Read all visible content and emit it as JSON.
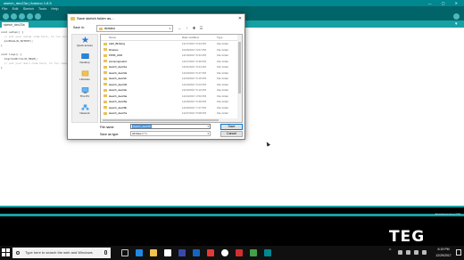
{
  "ide": {
    "title": "sketch_dec23a | Arduino 1.8.5",
    "menu": [
      "File",
      "Edit",
      "Sketch",
      "Tools",
      "Help"
    ],
    "tab": "sketch_dec23a",
    "code": [
      "void setup() {",
      "  // put your setup code here, to run once:",
      "  pinMode(8,OUTPUT);",
      "}",
      "",
      "void loop() {",
      "  digitalWrite(8,HIGH);",
      "  // put your main code here, to run repeatedly:",
      "}"
    ],
    "status": "Arduino/Genuino Uno on COM6",
    "accent": "#00878f"
  },
  "dialog": {
    "title": "Save sketch folder as...",
    "save_in_label": "Save in:",
    "save_in_value": "Arduino",
    "places": [
      "Quick access",
      "Desktop",
      "Libraries",
      "This PC",
      "Network"
    ],
    "columns": [
      "Name",
      "Date modified",
      "Type"
    ],
    "files": [
      {
        "name": "LED_Blinking",
        "date": "12/17/2017 6:34 PM",
        "type": "File folder"
      },
      {
        "name": "libraries",
        "date": "10/26/2017 6:57 PM",
        "type": "File folder"
      },
      {
        "name": "PWM_AKD",
        "date": "12/19/2017 6:34 PM",
        "type": "File folder"
      },
      {
        "name": "pwmpmgreehd",
        "date": "12/17/2017 6:36 PM",
        "type": "File folder"
      },
      {
        "name": "sketch_dec21a",
        "date": "12/21/2017 9:44 AM",
        "type": "File folder"
      },
      {
        "name": "sketch_dec23a",
        "date": "12/23/2017 5:27 PM",
        "type": "File folder"
      },
      {
        "name": "sketch_dec23c",
        "date": "12/23/2017 6:15 PM",
        "type": "File folder"
      },
      {
        "name": "sketch_dec23d",
        "date": "12/23/2017 6:23 PM",
        "type": "File folder"
      },
      {
        "name": "sketch_dec23e",
        "date": "12/23/2017 6:12 PM",
        "type": "File folder"
      },
      {
        "name": "sketch_dec24a",
        "date": "12/24/2017 2:53 PM",
        "type": "File folder"
      },
      {
        "name": "sketch_dec26a",
        "date": "12/26/2017 6:39 PM",
        "type": "File folder"
      },
      {
        "name": "sketch_dec26b",
        "date": "12/26/2017 7:27 PM",
        "type": "File folder"
      },
      {
        "name": "sketch_dec27a",
        "date": "12/27/2017 6:58 PM",
        "type": "File folder"
      }
    ],
    "file_name_label": "File name:",
    "file_name_value": "sketch_dec27b",
    "save_type_label": "Save as type:",
    "save_type_value": "All Files (*.*)",
    "save_button": "Save",
    "cancel_button": "Cancel",
    "close_glyph": "✕"
  },
  "taskbar": {
    "search_placeholder": "Type here to search the web and Windows",
    "time": "6:19 PM",
    "date": "12/29/2017",
    "watermark": "TEG"
  }
}
